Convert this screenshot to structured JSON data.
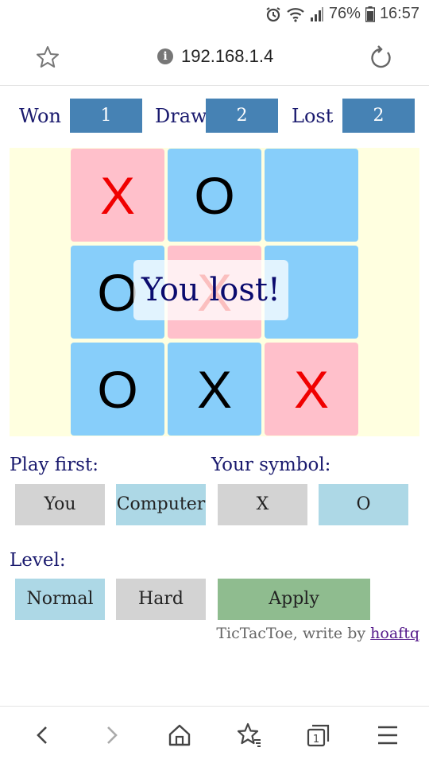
{
  "status_bar": {
    "battery_percent": "76%",
    "time": "16:57",
    "icons": [
      "alarm-icon",
      "wifi-icon",
      "signal-icon",
      "battery-icon"
    ]
  },
  "browser": {
    "url": "192.168.1.4",
    "icons": [
      "star-icon",
      "info-icon",
      "reload-icon"
    ],
    "bottom_nav": [
      "back-icon",
      "forward-icon",
      "home-icon",
      "bookmarks-icon",
      "tabs-icon",
      "menu-icon"
    ],
    "tabs_count": "1"
  },
  "score": {
    "won_label": "Won",
    "won_value": "1",
    "draw_label": "Draw",
    "draw_value": "2",
    "lost_label": "Lost",
    "lost_value": "2"
  },
  "board": {
    "cells": [
      "X",
      "O",
      "",
      "O",
      "X",
      "",
      "O",
      "X",
      "X"
    ],
    "cell_colors": [
      "pink",
      "blue",
      "blue",
      "blue",
      "pink",
      "blue",
      "blue",
      "blue",
      "pink"
    ],
    "result_message": "You lost!"
  },
  "options": {
    "play_first_label": "Play first:",
    "play_first_you": "You",
    "play_first_computer": "Computer",
    "your_symbol_label": "Your symbol:",
    "symbol_x": "X",
    "symbol_o": "O",
    "level_label": "Level:",
    "level_normal": "Normal",
    "level_hard": "Hard",
    "apply_label": "Apply"
  },
  "footer": {
    "text": "TicTacToe, write by ",
    "author_link": "hoaftq"
  },
  "colors": {
    "score_box": "#4682b4",
    "board_bg": "#ffffe0",
    "cell_pink": "#ffc0cb",
    "cell_blue": "#87cefa",
    "button_gray": "#d3d3d3",
    "button_light_blue": "#add8e6",
    "apply_green": "#8fbc8f"
  }
}
